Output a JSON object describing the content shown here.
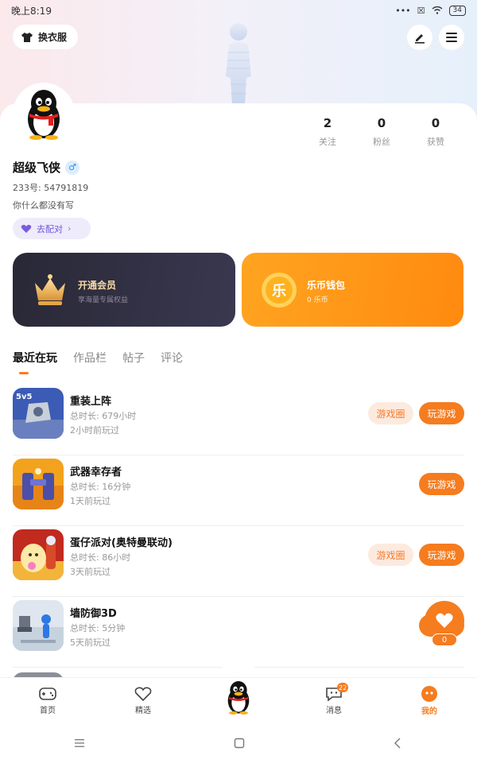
{
  "status_bar": {
    "time": "晚上8:19",
    "dots": "•••",
    "battery": "34"
  },
  "header": {
    "dress_up_label": "换衣服"
  },
  "profile": {
    "stats": [
      {
        "value": "2",
        "label": "关注"
      },
      {
        "value": "0",
        "label": "粉丝"
      },
      {
        "value": "0",
        "label": "获赞"
      }
    ],
    "username": "超级飞侠",
    "gender_symbol": "♂",
    "uid_text": "233号: 54791819",
    "bio": "你什么都没有写",
    "match_label": "去配对"
  },
  "cards": {
    "vip": {
      "title": "开通会员",
      "subtitle": "享海量专属权益"
    },
    "wallet": {
      "title": "乐币钱包",
      "subtitle": "0 乐币",
      "icon_char": "乐"
    }
  },
  "tabs": [
    "最近在玩",
    "作品栏",
    "帖子",
    "评论"
  ],
  "games": [
    {
      "title": "重装上阵",
      "total_time": "总时长: 679小时",
      "last_played": "2小时前玩过",
      "circle_label": "游戏圈",
      "play_label": "玩游戏"
    },
    {
      "title": "武器幸存者",
      "total_time": "总时长: 16分钟",
      "last_played": "1天前玩过",
      "play_label": "玩游戏"
    },
    {
      "title": "蛋仔派对(奥特曼联动)",
      "total_time": "总时长: 86小时",
      "last_played": "3天前玩过",
      "circle_label": "游戏圈",
      "play_label": "玩游戏"
    },
    {
      "title": "墙防御3D",
      "total_time": "总时长: 5分钟",
      "last_played": "5天前玩过",
      "play_label": "玩游戏"
    }
  ],
  "fab": {
    "like_count": "0"
  },
  "bottom_nav": [
    {
      "label": "首页"
    },
    {
      "label": "精选"
    },
    {
      "label": ""
    },
    {
      "label": "消息",
      "badge": "22"
    },
    {
      "label": "我的"
    }
  ],
  "colors": {
    "accent": "#f57c1f",
    "vip_dark": "#2b2a38",
    "wallet_orange": "#ff9418"
  }
}
